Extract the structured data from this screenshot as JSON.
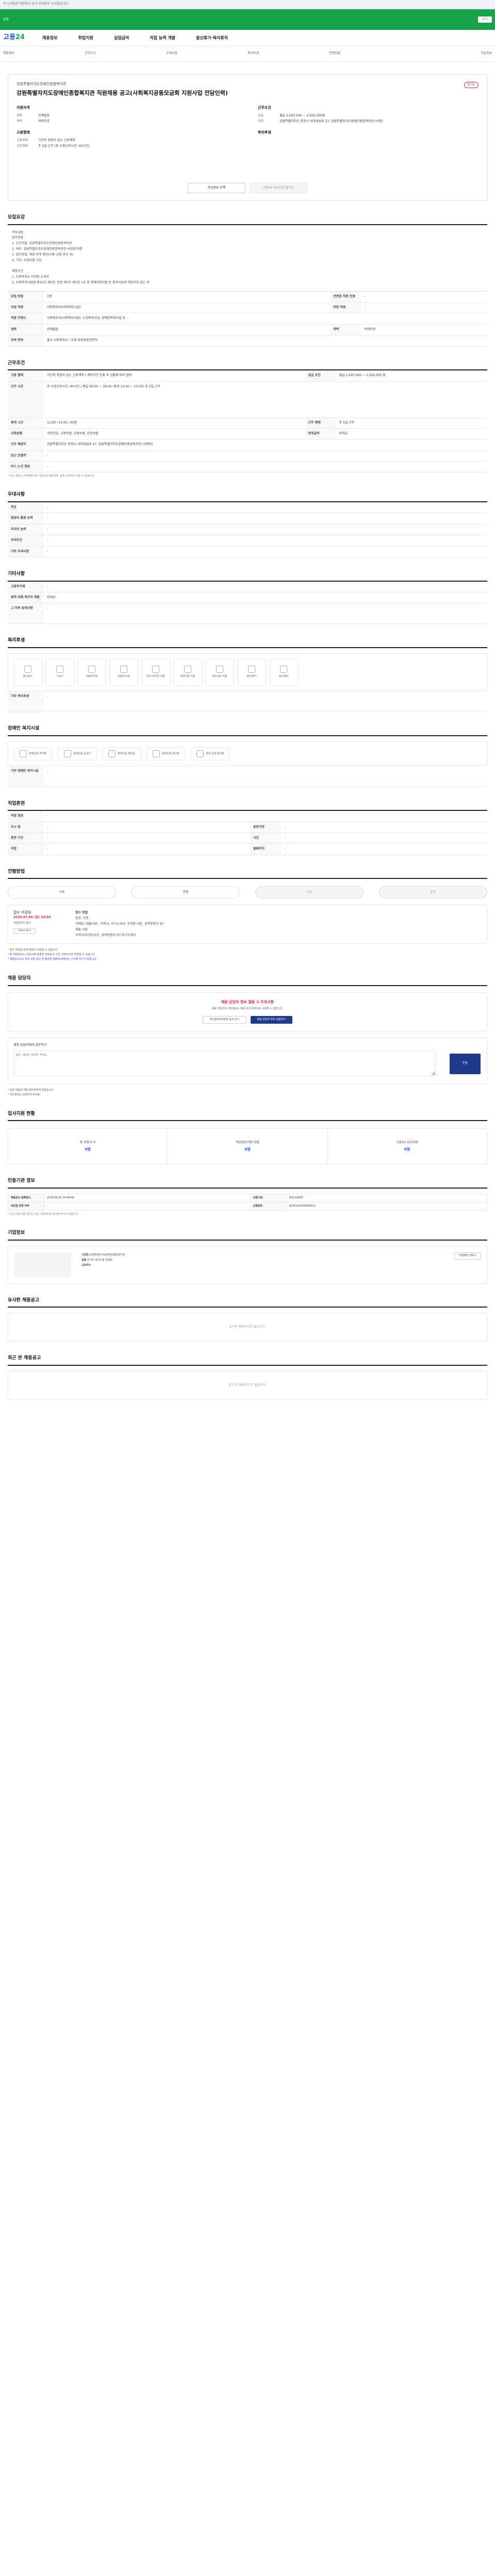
{
  "topbar": {
    "text": "이 누리집은 대한민국 공식 전자정부 누리집입니다."
  },
  "greenbar": {
    "left": "알림",
    "right_btn": "닫기"
  },
  "header": {
    "logo_main": "고용",
    "logo_num": "24",
    "nav": [
      "채용정보",
      "취업지원",
      "실업급여",
      "직업 능력 개발",
      "출산휴가·육아휴직"
    ]
  },
  "subnav": [
    "채용정보",
    "근무조건",
    "우대사항",
    "복리후생",
    "전형방법",
    "기업정보"
  ],
  "job": {
    "company": "강원특별자치도장애인종합복지관",
    "title": "강원특별자치도장애인종합복지관 직원채용 공고(사회복지공동모금회 지원사업 전담인력)",
    "dday": "D-16",
    "qual_title": "자원자격",
    "qual": [
      {
        "k": "경력",
        "v": "관계없음"
      },
      {
        "k": "학력",
        "v": "학력무관"
      }
    ],
    "cond_title": "근무조건",
    "cond": [
      {
        "k": "임금",
        "v": "월급 2,097,000 ~ 2,500,000원"
      },
      {
        "k": "지역",
        "v": "강원특별자치도 춘천시 서부대성로 27, 강원특별자치도장애인종합복지관 (서면)"
      }
    ],
    "emp_title": "고용형태",
    "emp": [
      {
        "k": "고용형태",
        "v": "기간의 정함이 있는 근로계약"
      },
      {
        "k": "근무형태",
        "v": "주 5일 근무 (주 소정근로시간: 40시간)"
      }
    ],
    "welfare_title": "복리후생",
    "btn_interest": "관심정보 등록",
    "btn_apply": "고용24 입사지원 불가능"
  },
  "summary": {
    "title": "모집요강",
    "text": "직무내용\n업무분장\n1. 신규직원: 강원특별자치도장애인종합복지관\n2. 세부: 강원특별자치도장애인종합복지관 사업에 따름\n3. 업무방법: 해당 자격 확인(서류 교환 준수 등)\n4. 기타: 사회보험 가입\n\n채용조건\n1. 사회복지사 자격증 소지자\n2. 사회복지사업법 제35조 제3항, 동법 제7조 제3항 1호 및 장애인복지법 등 결격사유에 해당하지 않는 자",
    "rows": [
      {
        "k": "모집 인원",
        "v": "1명",
        "k2": "관련된 직종 인원",
        "v2": "-"
      },
      {
        "k": "모집 직종",
        "v": "사회복지사(사회복지시설)",
        "k2": "관련 직종",
        "v2": "-"
      },
      {
        "k": "직종 키워드",
        "v": "사회복지사(사회복지사업), 노인복지사업, 장애인복지사업 등 ...",
        "k2": "",
        "v2": ""
      },
      {
        "k": "경력",
        "v": "관계없음",
        "k2": "학력",
        "v2": "학력무관"
      },
      {
        "k": "자격 면허",
        "v": "필수 사회복지사 / 우대 자동차운전면허",
        "k2": "",
        "v2": ""
      }
    ]
  },
  "work": {
    "title": "근무조건",
    "rows": [
      {
        "k": "고용 형태",
        "v": "기간의 정함이 있는 근로계약 / 계약기간 만료 후 상황에 따라 협의",
        "k2": "임금 조건",
        "v2": "월급 2,097,000 ~ 2,500,000 원"
      },
      {
        "k": "근무 시간",
        "v": "주 소정근로시간: 40시간 / 평일 09:00 ~ 18:00 (휴게 12:00 ~ 13:00) 주 5일 근무",
        "k2": "",
        "v2": ""
      },
      {
        "k": "휴게 시간",
        "v": "12:00~13:00 / 60분",
        "k2": "근무 형태",
        "v2": "주 5일 근무"
      },
      {
        "k": "사회보험",
        "v": "국민연금, 고용보험, 산재보험, 건강보험",
        "k2": "퇴직급여",
        "v2": "퇴직금"
      },
      {
        "k": "근무 예정지",
        "v": "강원특별자치도 춘천시 서부대성로 27, 강원특별자치도장애인종합복지관 (서면동)",
        "k2": "",
        "v2": ""
      },
      {
        "k": "인근 전철역",
        "v": "-",
        "k2": "",
        "v2": ""
      },
      {
        "k": "버스 노선 정보",
        "v": "-",
        "k2": "",
        "v2": ""
      }
    ],
    "note": "* 지도 정보는 근무예정지를 기준으로 제공되며, 실제 근무지와 다를 수 있습니다."
  },
  "pref": {
    "title": "우대사항",
    "rows": [
      {
        "k": "전공",
        "v": "-"
      },
      {
        "k": "컴퓨터 활용 능력",
        "v": "-"
      },
      {
        "k": "외국어 능력",
        "v": "-"
      },
      {
        "k": "우대조건",
        "v": "-"
      },
      {
        "k": "기타 우대사항",
        "v": "-"
      }
    ]
  },
  "other": {
    "title": "기타사항",
    "rows": [
      {
        "k": "고용허가제",
        "v": "-"
      },
      {
        "k": "병역 대체 복무자 채용",
        "v": "비대상"
      }
    ],
    "extra_k": "그 외의 유의사항",
    "extra_v": "-"
  },
  "benefit": {
    "title": "복리후생",
    "icons": [
      "통근버스",
      "기숙사",
      "차량유지비",
      "교육비 지원",
      "자녀 학자금 지원",
      "주택자금 지원",
      "경조사비 지원",
      "출산휴가",
      "육아휴직",
      "",
      "",
      "",
      "",
      ""
    ],
    "extra_k": "기타 복리후생",
    "extra_v": "-"
  },
  "disab": {
    "title": "장애인 복지시설",
    "icons": [
      "장애인용 주차장",
      "장애인용 승강기",
      "장애인용 화장실",
      "장애인용 경사로",
      "점자 안내 표지판"
    ],
    "extra_k": "기타 장애인 복지시설",
    "extra_v": "-"
  },
  "jobfair": {
    "title": "직업훈련",
    "rows": [
      {
        "k": "과정 명칭",
        "v": "-",
        "k2": "",
        "v2": ""
      },
      {
        "k": "주소 명",
        "v": "-",
        "k2": "훈련기관",
        "v2": "-"
      },
      {
        "k": "훈련 기간",
        "v": "-",
        "k2": "시간",
        "v2": "-"
      },
      {
        "k": "과정",
        "v": "-",
        "k2": "홈페이지",
        "v2": "-"
      }
    ]
  },
  "process": {
    "title": "전형방법",
    "steps": [
      "서류",
      "면접",
      "선발",
      "발표"
    ],
    "deadline_label": "접수 마감일",
    "deadline": "2025.07.06 (일) 23:59",
    "deadline_sub": "마감일까지 접수",
    "method_label": "접수 방법",
    "method": "방문, 우편\n이메일 (제출서류 : 이력서, 자기소개서, 자격증 사본, 경력증명서 등)\n제출 서류\n이력서(자격증사본, 경력증명서 등) 자기소개서",
    "btn_print": "이력서 양식",
    "warns": [
      "* 접수 마감일 전에 채용이 마감될 수 있습니다.",
      "* 본 채용정보는 고용24에 등록된 정보로서 기업 사정에 따라 변경될 수 있습니다.",
      "* 채용공고상의 허위·과장 광고 및 불공정 채용에 대해서는 신고해 주시기 바랍니다."
    ]
  },
  "contact": {
    "title": "채용 담당자",
    "privacy_head": "채용 담당자 정보 열람 시 주의사항",
    "privacy_text": "채용 담당자의 개인정보는 채용 외의 목적으로 사용할 수 없습니다.",
    "btn_agree": "개인정보처리방침 동의 보기",
    "btn_view": "채용 담당자 정보 열람하기",
    "qna_title": "채용 담당자에게 질문하기",
    "qna_placeholder": "질문 내용을 입력해 주세요.",
    "qna_submit": "전송",
    "notes": [
      "* 질문 내용은 채용 담당자에게 전달됩니다.",
      "* 개인정보는 입력하지 마세요."
    ]
  },
  "applstat": {
    "title": "입사지원 현황",
    "items": [
      {
        "k": "총 지원자 수",
        "v": "0명"
      },
      {
        "k": "직업정보지원 방법",
        "v": "0명"
      },
      {
        "k": "고용24 입사지원",
        "v": "0명"
      }
    ]
  },
  "reginfo": {
    "title": "인증기관 정보",
    "rows": [
      {
        "k": "채용공고 등록일시",
        "v": "2025.06.20 14:48:46",
        "k2": "인증기관",
        "v2": "춘천고용센터"
      },
      {
        "k": "마감일 연장 여부",
        "v": "-",
        "k2": "인증번호",
        "v2": "K150122506200012"
      }
    ],
    "note": "* 구인 인증 관련 문의는 담당 고용센터로 문의해 주시기 바랍니다."
  },
  "company": {
    "title": "기업정보",
    "rows": [
      {
        "k": "기업명",
        "v": "강원특별자치도장애인종합복지관"
      },
      {
        "k": "업종",
        "v": "비거주 복지시설 운영업"
      },
      {
        "k": "근로자수",
        "v": "-"
      }
    ],
    "btn": "기업정보 더보기"
  },
  "similar": {
    "title": "유사한 채용공고",
    "empty": "유사한 채용공고가 없습니다."
  },
  "recent": {
    "title": "최근 본 채용공고",
    "empty": "최근 본 채용공고가 없습니다."
  }
}
